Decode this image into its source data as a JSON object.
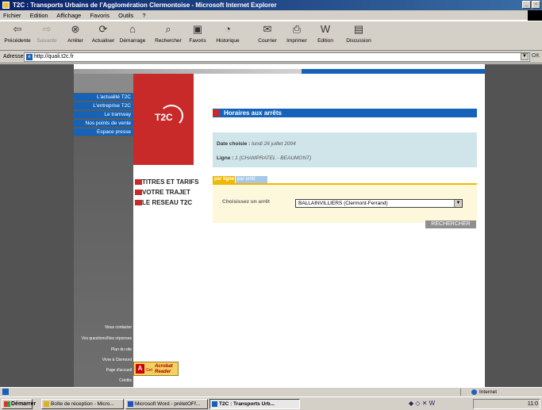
{
  "window": {
    "title": "T2C : Transports Urbains de l'Agglomération Clermontoise - Microsoft Internet Explorer"
  },
  "menu": [
    "Fichier",
    "Edition",
    "Affichage",
    "Favoris",
    "Outils",
    "?"
  ],
  "toolbar": [
    {
      "label": "Précédente",
      "icon": "back-arrow-icon"
    },
    {
      "label": "Suivante",
      "icon": "forward-arrow-icon"
    },
    {
      "label": "Arrêter",
      "icon": "stop-icon"
    },
    {
      "label": "Actualiser",
      "icon": "refresh-icon"
    },
    {
      "label": "Démarrage",
      "icon": "home-icon"
    },
    {
      "label": "Rechercher",
      "icon": "search-icon"
    },
    {
      "label": "Favoris",
      "icon": "favorites-icon"
    },
    {
      "label": "Historique",
      "icon": "history-icon"
    },
    {
      "label": "Courrier",
      "icon": "mail-icon"
    },
    {
      "label": "Imprimer",
      "icon": "print-icon"
    },
    {
      "label": "Edition",
      "icon": "edit-icon"
    },
    {
      "label": "Discussion",
      "icon": "discuss-icon"
    }
  ],
  "address": {
    "label": "Adresse",
    "url": "http://quali.t2c.fr",
    "go": "OK"
  },
  "sidebar": {
    "items": [
      "L'actualité T2C",
      "L'entreprise T2C",
      "Le tramway",
      "Nos points de vente",
      "Espace presse"
    ],
    "footer_links": [
      "Nous contacter",
      "Vos questions/Nos réponses",
      "Plan du site",
      "Vivre à Clermont",
      "Page d'accueil",
      "Crédits"
    ]
  },
  "logo": {
    "text": "T2C"
  },
  "main_nav": [
    "TITRES ET TARIFS",
    "VOTRE TRAJET",
    "LE RESEAU T2C"
  ],
  "content": {
    "section_title": "Horaires aux arrêts",
    "date_label": "Date choisie :",
    "date_value": "lundi 26 juillet 2004",
    "ligne_label": "Ligne :",
    "ligne_value": "1 (CHAMPRATEL - BEAUMONT)",
    "tabs": [
      "par ligne",
      "par arrêt"
    ],
    "choose_label": "Choisissez un arrêt",
    "select_value": "BALLAINVILLIERS (Clermont-Ferrand)",
    "search_button": "RECHERCHER"
  },
  "adobe": {
    "get": "Get",
    "product": "Acrobat Reader"
  },
  "status": {
    "zone": "Internet"
  },
  "taskbar": {
    "start": "Démarrer",
    "tasks": [
      "Boîte de réception - Micro...",
      "Microsoft Word - prétetOFf...",
      "T2C : Transports Urb..."
    ],
    "clock": "11:0"
  }
}
